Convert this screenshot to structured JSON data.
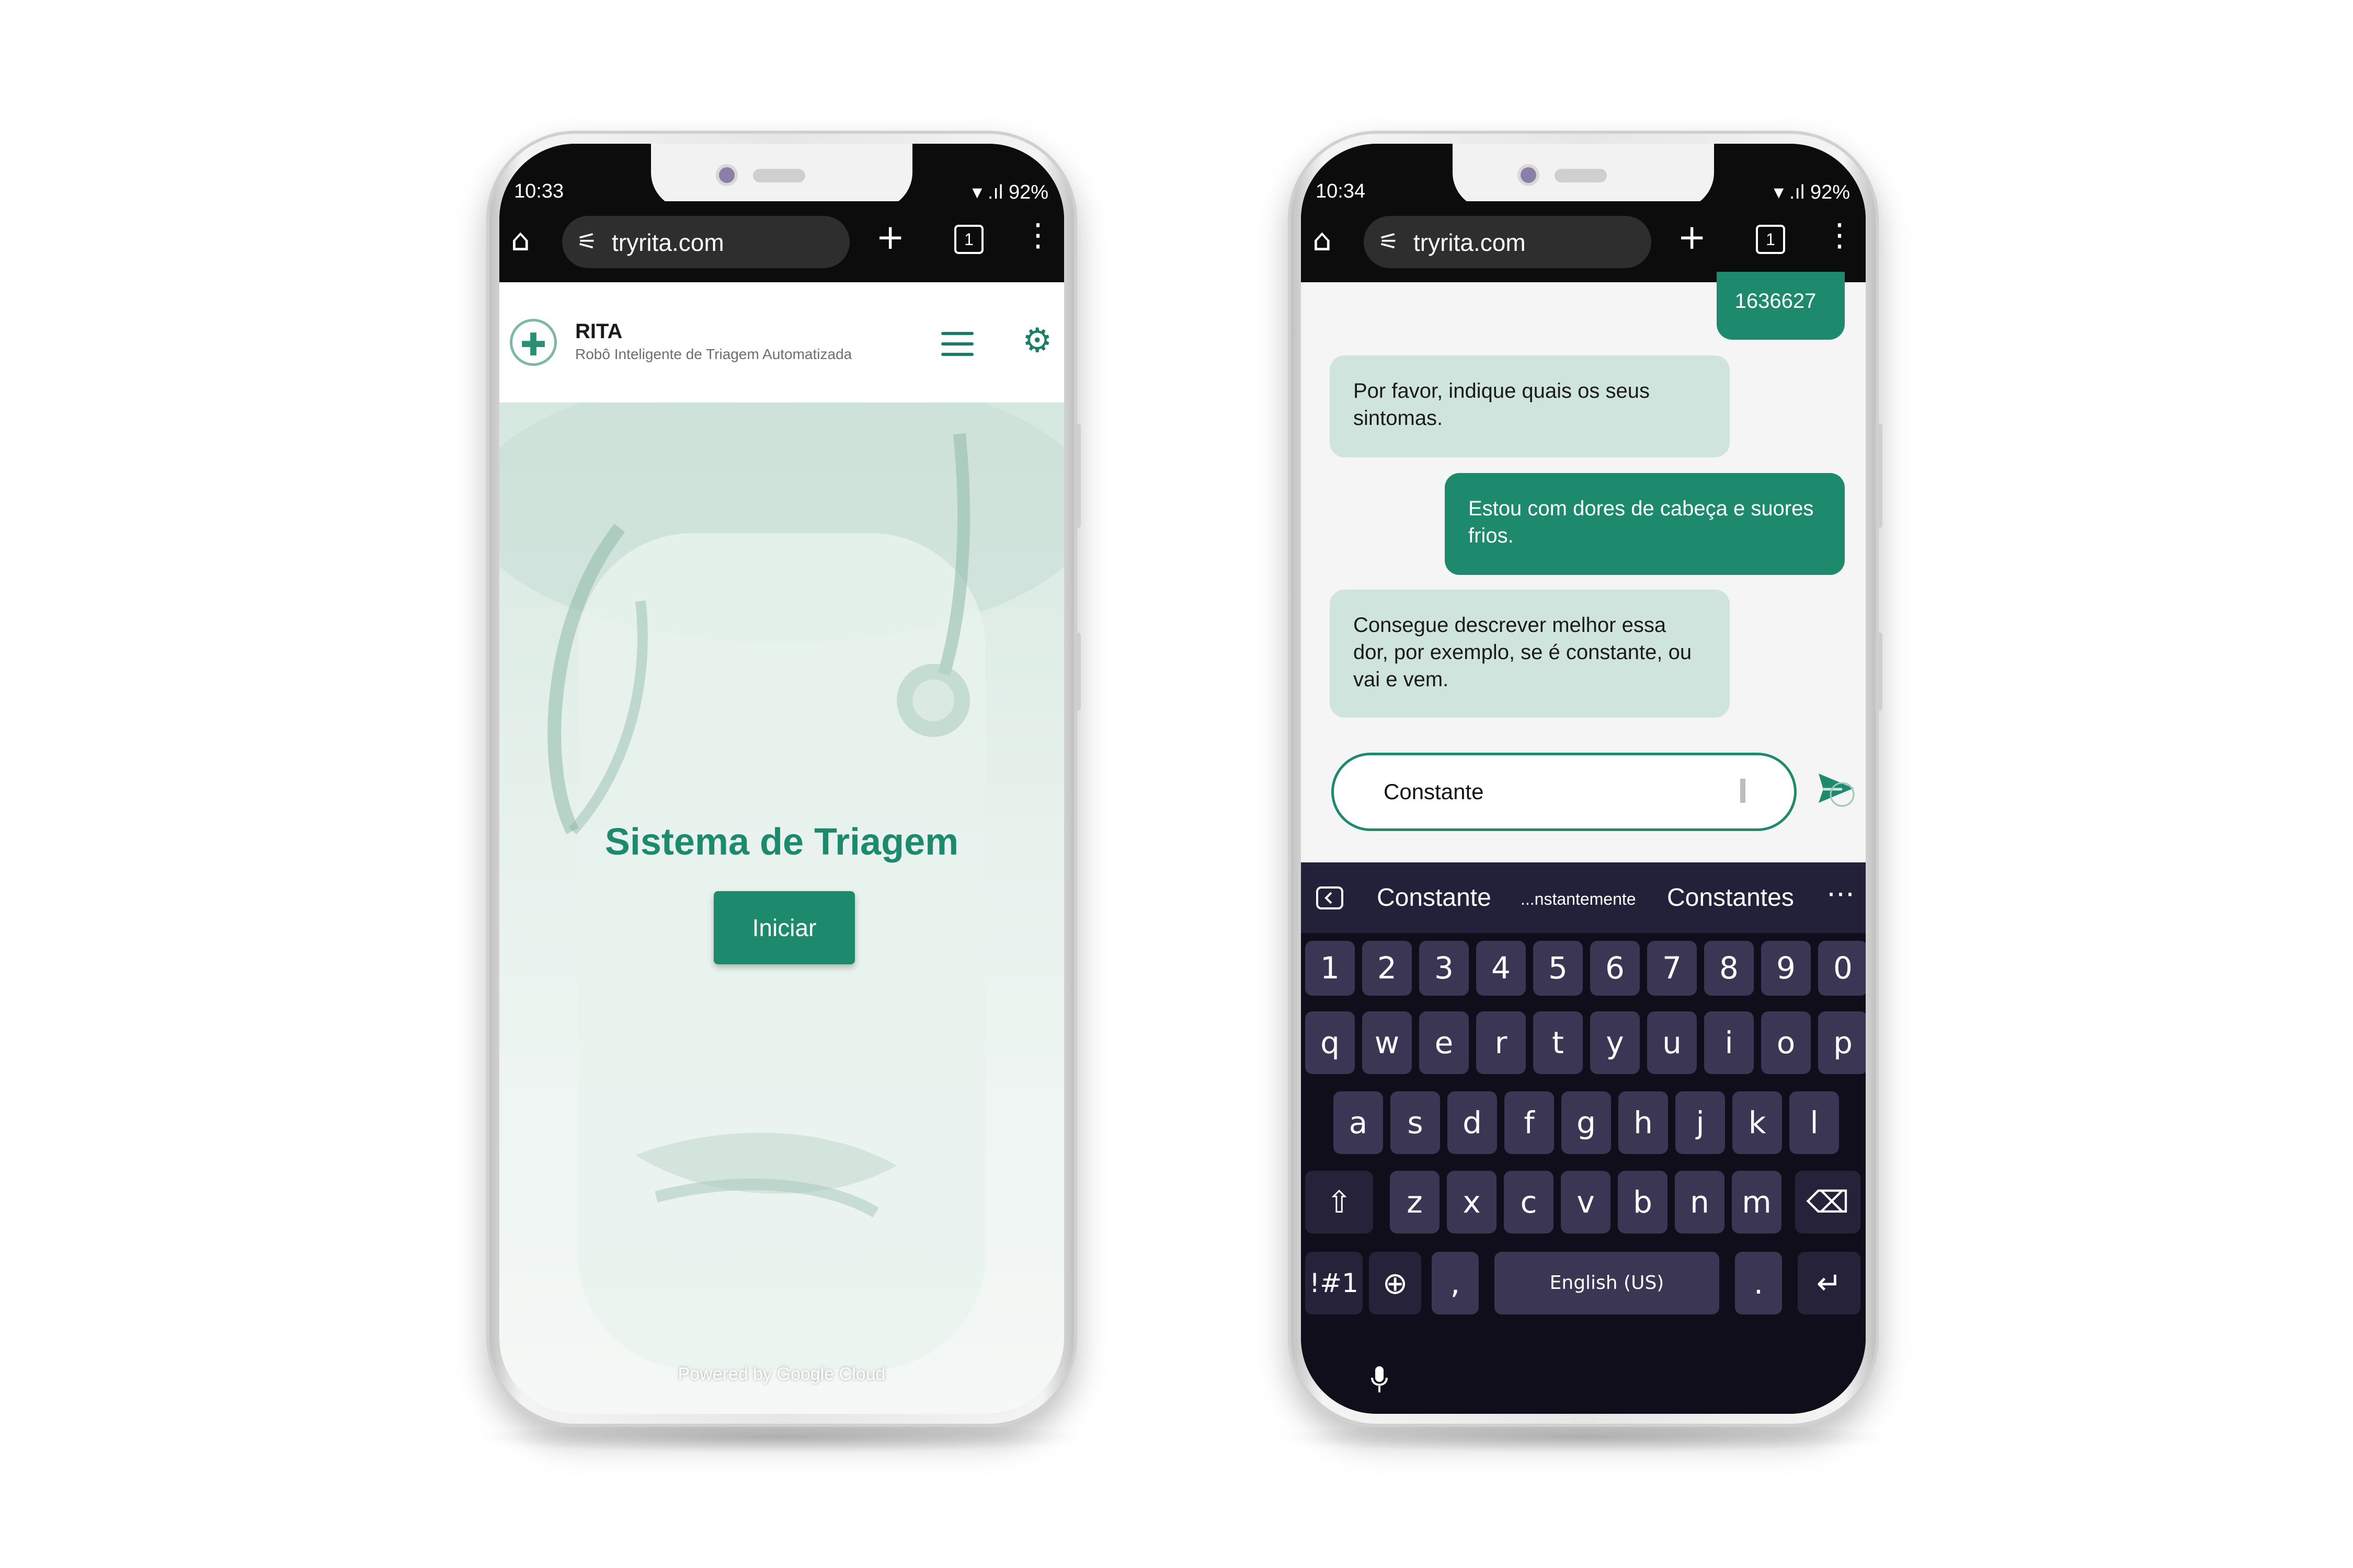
{
  "left_phone": {
    "status": {
      "time": "10:33",
      "battery": "92%"
    },
    "browser": {
      "url": "tryrita.com",
      "tab_count": "1"
    },
    "app": {
      "title": "RITA",
      "subtitle": "Robô Inteligente de Triagem Automatizada",
      "hero_title": "Sistema de Triagem",
      "start_button": "Iniciar",
      "footer": "Powered by Google Cloud"
    }
  },
  "right_phone": {
    "status": {
      "time": "10:34",
      "battery": "92%"
    },
    "browser": {
      "url": "tryrita.com",
      "tab_count": "1"
    },
    "chat": {
      "messages": [
        {
          "from": "user",
          "text": "1636627"
        },
        {
          "from": "bot",
          "text": "Por favor, indique quais os seus sintomas."
        },
        {
          "from": "user",
          "text": "Estou com dores de cabeça e suores frios."
        },
        {
          "from": "bot",
          "text": "Consegue descrever melhor essa dor, por exemplo, se é constante, ou vai e vem."
        }
      ],
      "input_value": "Constante"
    },
    "keyboard": {
      "suggestions": [
        "Constante",
        "...nstantemente",
        "Constantes"
      ],
      "more": "⋯",
      "row_numbers": [
        "1",
        "2",
        "3",
        "4",
        "5",
        "6",
        "7",
        "8",
        "9",
        "0"
      ],
      "row_1": [
        "q",
        "w",
        "e",
        "r",
        "t",
        "y",
        "u",
        "i",
        "o",
        "p"
      ],
      "row_2": [
        "a",
        "s",
        "d",
        "f",
        "g",
        "h",
        "j",
        "k",
        "l"
      ],
      "row_3": [
        "z",
        "x",
        "c",
        "v",
        "b",
        "n",
        "m"
      ],
      "symbols_key": "!#1",
      "comma_key": ",",
      "space_label": "English (US)",
      "period_key": "."
    }
  },
  "colors": {
    "brand_green": "#1e8a6d",
    "bot_bubble": "#cfe4dc",
    "keyboard_bg": "#0f0e1a",
    "key_bg": "#3a3654"
  }
}
